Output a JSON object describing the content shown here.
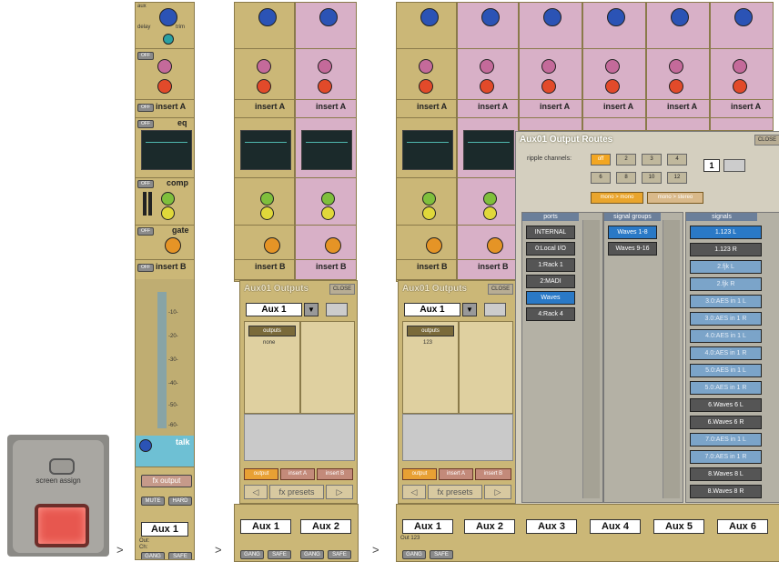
{
  "hardware": {
    "button_label": "screen assign"
  },
  "arrows": [
    ">",
    ">",
    ">"
  ],
  "strip_labels": {
    "aux": "aux",
    "delay": "delay",
    "trim": "trim",
    "off": "OFF",
    "insert_a": "insert A",
    "insert_b": "insert B",
    "eq": "eq",
    "comp": "comp",
    "gate": "gate",
    "talk": "talk",
    "fx_output": "fx output",
    "mute": "MUTE",
    "hard": "HARD",
    "gang": "GANG",
    "safe": "SAFE",
    "out": "Out:",
    "ch": "Ch:"
  },
  "view1": {
    "name": "Aux 1",
    "meter_ticks": [
      "-10-",
      "-20-",
      "-30-",
      "-40-",
      "-50-",
      "-60-"
    ]
  },
  "view2": {
    "panel_title": "Aux01 Outputs",
    "close": "CLOSE",
    "select_value": "Aux 1",
    "outputs_button": "outputs",
    "outputs_value": "none",
    "tabs": [
      "output",
      "insert A",
      "insert B"
    ],
    "presets": "fx presets",
    "names": [
      "Aux 1",
      "Aux 2"
    ]
  },
  "view3": {
    "panel_title": "Aux01 Outputs",
    "close": "CLOSE",
    "select_value": "Aux 1",
    "outputs_button": "outputs",
    "outputs_value": "123",
    "tabs": [
      "output",
      "insert A",
      "insert B"
    ],
    "presets": "fx presets",
    "names": [
      "Aux 1",
      "Aux 2",
      "Aux 3",
      "Aux 4",
      "Aux 5",
      "Aux 6"
    ],
    "out1": "Out 123"
  },
  "routes": {
    "title": "Aux01 Output Routes",
    "close": "CLOSE",
    "ripple_label": "ripple channels:",
    "ripple_buttons": [
      "off",
      "2",
      "3",
      "4",
      "6",
      "8",
      "10",
      "12"
    ],
    "ripple_value": "1",
    "mono_mono": "mono > mono",
    "mono_stereo": "mono > stereo",
    "ports_header": "ports",
    "groups_header": "signal groups",
    "signals_header": "signals",
    "ports": [
      "INTERNAL",
      "0:Local I/O",
      "1:Rack 1",
      "2:MADI",
      "Waves",
      "4:Rack 4"
    ],
    "groups": [
      "Waves 1-8",
      "Waves 9-16"
    ],
    "signals": [
      "1.123 L",
      "1.123 R",
      "2.fjk L",
      "2.fjk R",
      "3.0:AES in 1 L",
      "3.0:AES in 1 R",
      "4.0:AES in 1 L",
      "4.0:AES in 1 R",
      "5.0:AES in 1 L",
      "5.0:AES in 1 R",
      "6.Waves 6 L",
      "6.Waves 6 R",
      "7.0:AES in 1 L",
      "7.0:AES in 1 R",
      "8.Waves 8 L",
      "8.Waves 8 R"
    ]
  }
}
